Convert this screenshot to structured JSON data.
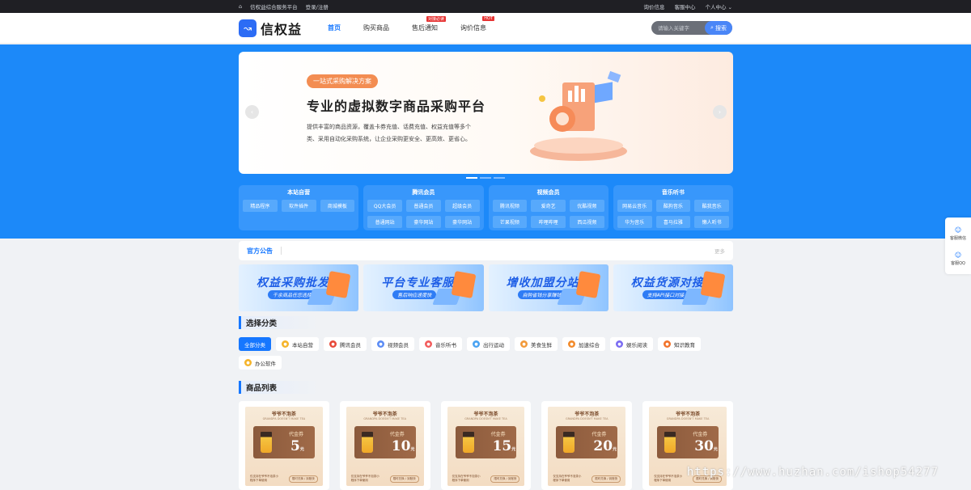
{
  "topbar": {
    "home_icon": "home-icon",
    "site_name": "信权益综合服务平台",
    "login": "登录/注册",
    "links": [
      "询价信息",
      "客服中心",
      "个人中心"
    ]
  },
  "header": {
    "logo": "信权益",
    "nav": [
      {
        "label": "首页",
        "badge": ""
      },
      {
        "label": "购买商品",
        "badge": ""
      },
      {
        "label": "售后通知",
        "badge": "对接必读"
      },
      {
        "label": "询价信息",
        "badge": "HOT"
      }
    ],
    "search_placeholder": "请输入关键字",
    "search_btn": "搜索"
  },
  "banner": {
    "tag": "一站式采购解决方案",
    "title": "专业的虚拟数字商品采购平台",
    "desc": "提供丰富的商品资源，覆盖卡券充值、话费充值、权益充值等多个类、采用自动化采购系统，让企业采购更安全、更高效、更省心。",
    "prev": "‹",
    "next": "›"
  },
  "categories": [
    {
      "title": "本站自营",
      "items": [
        "精品程序",
        "软件插件",
        "商城模板"
      ]
    },
    {
      "title": "腾讯会员",
      "items": [
        "QQ大会员",
        "普通会员",
        "超级会员",
        "普通网站",
        "豪华网站",
        "豪华网站"
      ]
    },
    {
      "title": "视频会员",
      "items": [
        "腾讯视频",
        "爱奇艺",
        "优酷视频",
        "芒果视频",
        "哔哩哔哩",
        "西瓜视频"
      ]
    },
    {
      "title": "音乐听书",
      "items": [
        "网易云音乐",
        "酷狗音乐",
        "酷我音乐",
        "华为音乐",
        "喜马拉雅",
        "懒人听书"
      ]
    }
  ],
  "notice": {
    "title": "官方公告",
    "more": "更多"
  },
  "promos": [
    {
      "big": "权益采购批发",
      "small": "千余商品任您选择"
    },
    {
      "big": "平台专业客服",
      "small": "售后响应速度快"
    },
    {
      "big": "增收加盟分站",
      "small": "自购省钱分享赚钱"
    },
    {
      "big": "权益货源对接",
      "small": "支持API接口对接"
    }
  ],
  "section_select": "选择分类",
  "filters": [
    {
      "label": "全部分类",
      "on": true,
      "color": ""
    },
    {
      "label": "本站自营",
      "color": "#f5b42a"
    },
    {
      "label": "腾讯会员",
      "color": "#e84a3a"
    },
    {
      "label": "视频会员",
      "color": "#5b8cf5"
    },
    {
      "label": "音乐听书",
      "color": "#f25c5c"
    },
    {
      "label": "出行运动",
      "color": "#4aa3f2"
    },
    {
      "label": "美食生鲜",
      "color": "#f29a3a"
    },
    {
      "label": "加速综合",
      "color": "#f28a2a"
    },
    {
      "label": "娱乐阅读",
      "color": "#7b6cf2"
    },
    {
      "label": "知识教育",
      "color": "#f2732a"
    },
    {
      "label": "办公软件",
      "color": "#f5b42a"
    }
  ],
  "section_products": "商品列表",
  "products": [
    {
      "header": "爷爷不泡茶",
      "sub": "GRANDPA DOESN'T MAKE TEA",
      "label": "代金券",
      "amount": "5",
      "unit": "元",
      "foot": "仅支持在爷爷不泡茶小程序下单使用",
      "btn": "限时兑换 / 到账快"
    },
    {
      "header": "爷爷不泡茶",
      "sub": "GRANDPA DOESN'T MAKE TEA",
      "label": "代金券",
      "amount": "10",
      "unit": "元",
      "foot": "仅支持在爷爷不泡茶小程序下单使用",
      "btn": "限时兑换 / 到账快"
    },
    {
      "header": "爷爷不泡茶",
      "sub": "GRANDPA DOESN'T MAKE TEA",
      "label": "代金券",
      "amount": "15",
      "unit": "元",
      "foot": "仅支持在爷爷不泡茶小程序下单使用",
      "btn": "限时兑换 / 到账快"
    },
    {
      "header": "爷爷不泡茶",
      "sub": "GRANDPA DOESN'T MAKE TEA",
      "label": "代金券",
      "amount": "20",
      "unit": "元",
      "foot": "仅支持在爷爷不泡茶小程序下单使用",
      "btn": "限时兑换 / 到账快"
    },
    {
      "header": "爷爷不泡茶",
      "sub": "GRANDPA DOESN'T MAKE TEA",
      "label": "代金券",
      "amount": "30",
      "unit": "元",
      "foot": "仅支持在爷爷不泡茶小程序下单使用",
      "btn": "限时兑换 / 到账快"
    }
  ],
  "side": [
    {
      "label": "客服微信",
      "icon": "wechat-icon"
    },
    {
      "label": "客服QQ",
      "icon": "qq-icon"
    }
  ],
  "watermark": "https://www.huzhan.com/ishop54277"
}
